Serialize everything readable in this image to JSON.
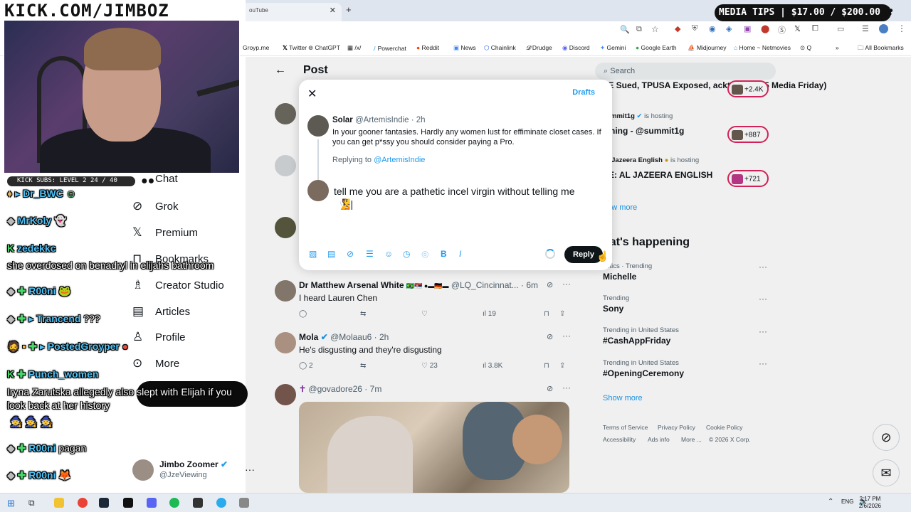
{
  "browser": {
    "tab_title": "ouTube",
    "bookmarks": [
      "Groyp.me",
      "Twitter",
      "ChatGPT",
      "/x/",
      "Powerchat",
      "Reddit",
      "News",
      "Chainlink",
      "Drudge",
      "Discord",
      "Gemini",
      "Google Earth",
      "Midjourney",
      "Home ~ Netmovies",
      "Q"
    ],
    "all_bookmarks": "All Bookmarks"
  },
  "overlay": {
    "kick_url": "KICK.COM/JIMBOZ",
    "media_tips": "MEDIA TIPS | $17.00 / $200.00",
    "kick_subs": "KICK SUBS: LEVEL 2 24 / 40"
  },
  "nav": {
    "items": [
      "Chat",
      "Grok",
      "Premium",
      "Bookmarks",
      "Creator Studio",
      "Articles",
      "Profile",
      "More"
    ]
  },
  "chat": {
    "lines": [
      {
        "name": "Dr_BWC",
        "msg": ""
      },
      {
        "name": "MrKoly",
        "msg": ""
      },
      {
        "name": "zedekkc",
        "msg": "she overdosed on benadryl in elijahs bathroom"
      },
      {
        "name": "R00ni",
        "msg": ""
      },
      {
        "name": "Trancend",
        "msg": "???"
      },
      {
        "name": "PostedGroyper",
        "msg": ""
      },
      {
        "name": "Punch_women",
        "msg": "Iryna Zarutska allegedly also slept with Elijah if you look back at her history"
      },
      {
        "name": "R00ni",
        "msg": "pagan"
      },
      {
        "name": "R00ni",
        "msg": ""
      }
    ]
  },
  "user": {
    "name": "Jimbo Zoomer",
    "handle": "@JzeViewing"
  },
  "feed": {
    "header": "Post",
    "tweets": [
      {
        "name": "Dr Matthew Arsenal White",
        "handle": "@LQ_Cincinnat... · 6m",
        "text": "I heard Lauren Chen",
        "replies": "",
        "reposts": "",
        "likes": "",
        "views": "19"
      },
      {
        "name": "Mola",
        "handle": "@Molaau6 · 2h",
        "text": "He's disgusting and they're disgusting",
        "replies": "2",
        "reposts": "",
        "likes": "23",
        "views": "3.8K"
      },
      {
        "name": "",
        "handle": "@govadore26 · 7m",
        "text": "",
        "replies": "",
        "reposts": "",
        "likes": "",
        "views": ""
      }
    ]
  },
  "right": {
    "search_placeholder": "Search",
    "spaces": [
      {
        "title": "TE Sued, TPUSA Exposed, acktivities ($5 Media Friday)",
        "host": "",
        "count": "+2.4K"
      },
      {
        "title": "aming - @summit1g",
        "host": "summit1g",
        "status": "is hosting",
        "count": "+887"
      },
      {
        "title": "VE: AL JAZEERA ENGLISH",
        "host": "Al Jazeera English",
        "status": "is hosting",
        "count": "+721"
      }
    ],
    "show_more_top": "how more",
    "whats_happening": "hat's happening",
    "trends": [
      {
        "context": "olitics · Trending",
        "name": "Michelle"
      },
      {
        "context": "Trending",
        "name": "Sony"
      },
      {
        "context": "Trending in United States",
        "name": "#CashAppFriday"
      },
      {
        "context": "Trending in United States",
        "name": "#OpeningCeremony"
      }
    ],
    "show_more": "Show more",
    "footer": [
      "Terms of Service",
      "Privacy Policy",
      "Cookie Policy",
      "Accessibility",
      "Ads info",
      "More ...",
      "© 2026 X Corp."
    ]
  },
  "modal": {
    "drafts": "Drafts",
    "quoted_name": "Solar",
    "quoted_handle": "@ArtemisIndie · 2h",
    "quoted_text": "In your gooner fantasies. Hardly any women lust for effiminate closet cases. If you can get p*ssy you should consider paying a Pro.",
    "replying_label": "Replying to",
    "replying_handle": "@ArtemisIndie",
    "draft_text": "tell me you are a pathetic incel virgin without telling me",
    "reply_button": "Reply"
  },
  "taskbar": {
    "lang": "ENG",
    "time": "2:17 PM",
    "date": "2/6/2026"
  },
  "colors": {
    "accent": "#1d9bf0",
    "text": "#0f1419",
    "muted": "#536471",
    "live": "#e0245e"
  }
}
